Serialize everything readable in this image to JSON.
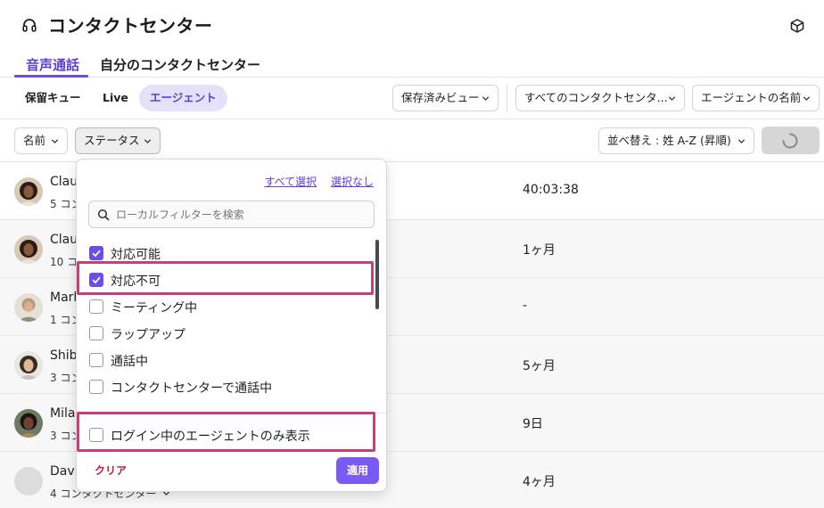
{
  "header": {
    "title": "コンタクトセンター"
  },
  "tabs": [
    {
      "label": "音声通話",
      "active": true
    },
    {
      "label": "自分のコンタクトセンター",
      "active": false
    }
  ],
  "subtabs": [
    {
      "label": "保留キュー"
    },
    {
      "label": "Live"
    },
    {
      "label": "エージェント",
      "active": true
    }
  ],
  "filters": {
    "saved_view": "保存済みビュー",
    "contact_center": "すべてのコンタクトセンタ...",
    "agent_name": "エージェントの名前",
    "name": "名前",
    "status": "ステータス",
    "sort": "並べ替え : 姓 A-Z (昇順)"
  },
  "rows": [
    {
      "name": "Clau",
      "sub": "5 コン",
      "time": "40:03:38",
      "dimmed": false
    },
    {
      "name": "Clau",
      "sub": "10 コ",
      "time": "1ヶ月",
      "dimmed": true
    },
    {
      "name": "Mark",
      "sub": "1 コン",
      "time": "-",
      "dimmed": true
    },
    {
      "name": "Shib",
      "sub": "3 コン",
      "time": "5ヶ月",
      "dimmed": true
    },
    {
      "name": "Mila",
      "sub": "3 コン",
      "time": "9日",
      "dimmed": true
    },
    {
      "name": "David",
      "sub": "4 コンタクトセンター",
      "time": "4ヶ月",
      "dimmed": true
    }
  ],
  "popover": {
    "select_all": "すべて選択",
    "select_none": "選択なし",
    "search_placeholder": "ローカルフィルターを検索",
    "options": [
      {
        "label": "対応可能",
        "checked": true
      },
      {
        "label": "対応不可",
        "checked": true
      },
      {
        "label": "ミーティング中",
        "checked": false
      },
      {
        "label": "ラップアップ",
        "checked": false
      },
      {
        "label": "通話中",
        "checked": false
      },
      {
        "label": "コンタクトセンターで通話中",
        "checked": false
      }
    ],
    "logged_in_only": {
      "label": "ログイン中のエージェントのみ表示",
      "checked": false
    },
    "clear": "クリア",
    "apply": "適用"
  },
  "colors": {
    "accent": "#6b4ee6",
    "highlight": "#c83f7a",
    "clear": "#c0183a"
  },
  "icons": {
    "header": "headphones-icon",
    "corner": "cube-icon"
  }
}
